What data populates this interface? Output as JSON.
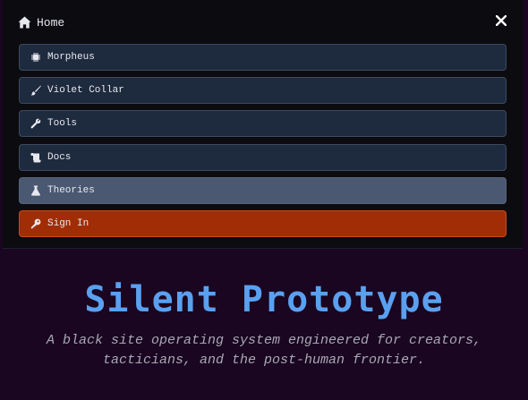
{
  "nav": {
    "home_label": "Home",
    "items": [
      {
        "label": "Morpheus",
        "icon": "chip-icon"
      },
      {
        "label": "Violet Collar",
        "icon": "brush-icon"
      },
      {
        "label": "Tools",
        "icon": "wrench-icon"
      },
      {
        "label": "Docs",
        "icon": "scroll-icon"
      },
      {
        "label": "Theories",
        "icon": "flask-icon"
      },
      {
        "label": "Sign In",
        "icon": "key-icon"
      }
    ],
    "active_item": "Theories"
  },
  "hero": {
    "title": "Silent Prototype",
    "subtitle": "A black site operating system engineered for creators, tacticians, and the post-human frontier."
  },
  "colors": {
    "page_bg": "#1a0620",
    "menu_bg": "#0b0b10",
    "item_bg": "#1e2a3e",
    "active_bg": "#4a5872",
    "signin_bg": "#a02d06",
    "title": "#5aa0f0"
  }
}
